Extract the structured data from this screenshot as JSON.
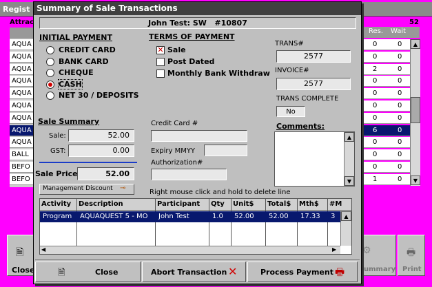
{
  "background_window": {
    "title_fragment": "Regist",
    "tab_fragment": "Attrac",
    "count": "52",
    "col_res": "Res.",
    "col_wait": "Wait",
    "rows": [
      {
        "name": "AQUA",
        "res": "0",
        "wait": "0",
        "selected": false
      },
      {
        "name": "AQUA",
        "res": "0",
        "wait": "0",
        "selected": false
      },
      {
        "name": "AQUA",
        "res": "2",
        "wait": "0",
        "selected": false
      },
      {
        "name": "AQUA",
        "res": "0",
        "wait": "0",
        "selected": false
      },
      {
        "name": "AQUA",
        "res": "0",
        "wait": "0",
        "selected": false
      },
      {
        "name": "AQUA",
        "res": "0",
        "wait": "0",
        "selected": false
      },
      {
        "name": "AQUA",
        "res": "0",
        "wait": "0",
        "selected": false
      },
      {
        "name": "AQUA",
        "res": "6",
        "wait": "0",
        "selected": true
      },
      {
        "name": "AQUA",
        "res": "0",
        "wait": "0",
        "selected": false
      },
      {
        "name": "BALL",
        "res": "0",
        "wait": "0",
        "selected": false
      },
      {
        "name": "BEFO",
        "res": "0",
        "wait": "0",
        "selected": false
      },
      {
        "name": "BEFO",
        "res": "1",
        "wait": "0",
        "selected": false
      }
    ],
    "close_label": "Close",
    "summary_label": "ummary",
    "print_label": "Print"
  },
  "dialog": {
    "title": "Summary of Sale Transactions",
    "header": "John Test: SW   #10807",
    "initial_payment": {
      "heading": "INITIAL PAYMENT",
      "options": [
        {
          "label": "CREDIT CARD",
          "selected": false
        },
        {
          "label": "BANK CARD",
          "selected": false
        },
        {
          "label": "CHEQUE",
          "selected": false
        },
        {
          "label": "CASH",
          "selected": true
        },
        {
          "label": "NET 30 / DEPOSITS",
          "selected": false
        }
      ]
    },
    "terms": {
      "heading": "TERMS OF PAYMENT",
      "options": [
        {
          "label": "Sale",
          "checked": true
        },
        {
          "label": "Post Dated",
          "checked": false
        },
        {
          "label": "Monthly Bank Withdraw",
          "checked": false
        }
      ]
    },
    "trans_label": "TRANS#",
    "trans_value": "2577",
    "invoice_label": "INVOICE#",
    "invoice_value": "2577",
    "trans_complete_label": "TRANS COMPLETE",
    "trans_complete_value": "No",
    "comments_label": "Comments:",
    "sale_summary": {
      "heading": "Sale Summary",
      "sale_label": "Sale:",
      "sale_value": "52.00",
      "gst_label": "GST:",
      "gst_value": "0.00",
      "price_label": "Sale Price",
      "price_value": "52.00"
    },
    "mgmt_discount_label": "Management Discount",
    "credit_card_label": "Credit Card #",
    "expiry_label": "Expiry MMYY",
    "auth_label": "Authorization#",
    "hint": "Right mouse click and hold to delete line",
    "table": {
      "headers": [
        "Activity",
        "Description",
        "Participant",
        "Qty",
        "Unit$",
        "Total$",
        "Mth$",
        "#M"
      ],
      "rows": [
        {
          "activity": "Program",
          "description": "AQUAQUEST 5 - MO",
          "participant": "John Test",
          "qty": "1.0",
          "unit": "52.00",
          "total": "52.00",
          "mth": "17.33",
          "m": "3"
        }
      ]
    },
    "buttons": {
      "close": "Close",
      "abort": "Abort Transaction",
      "process": "Process Payment"
    }
  }
}
